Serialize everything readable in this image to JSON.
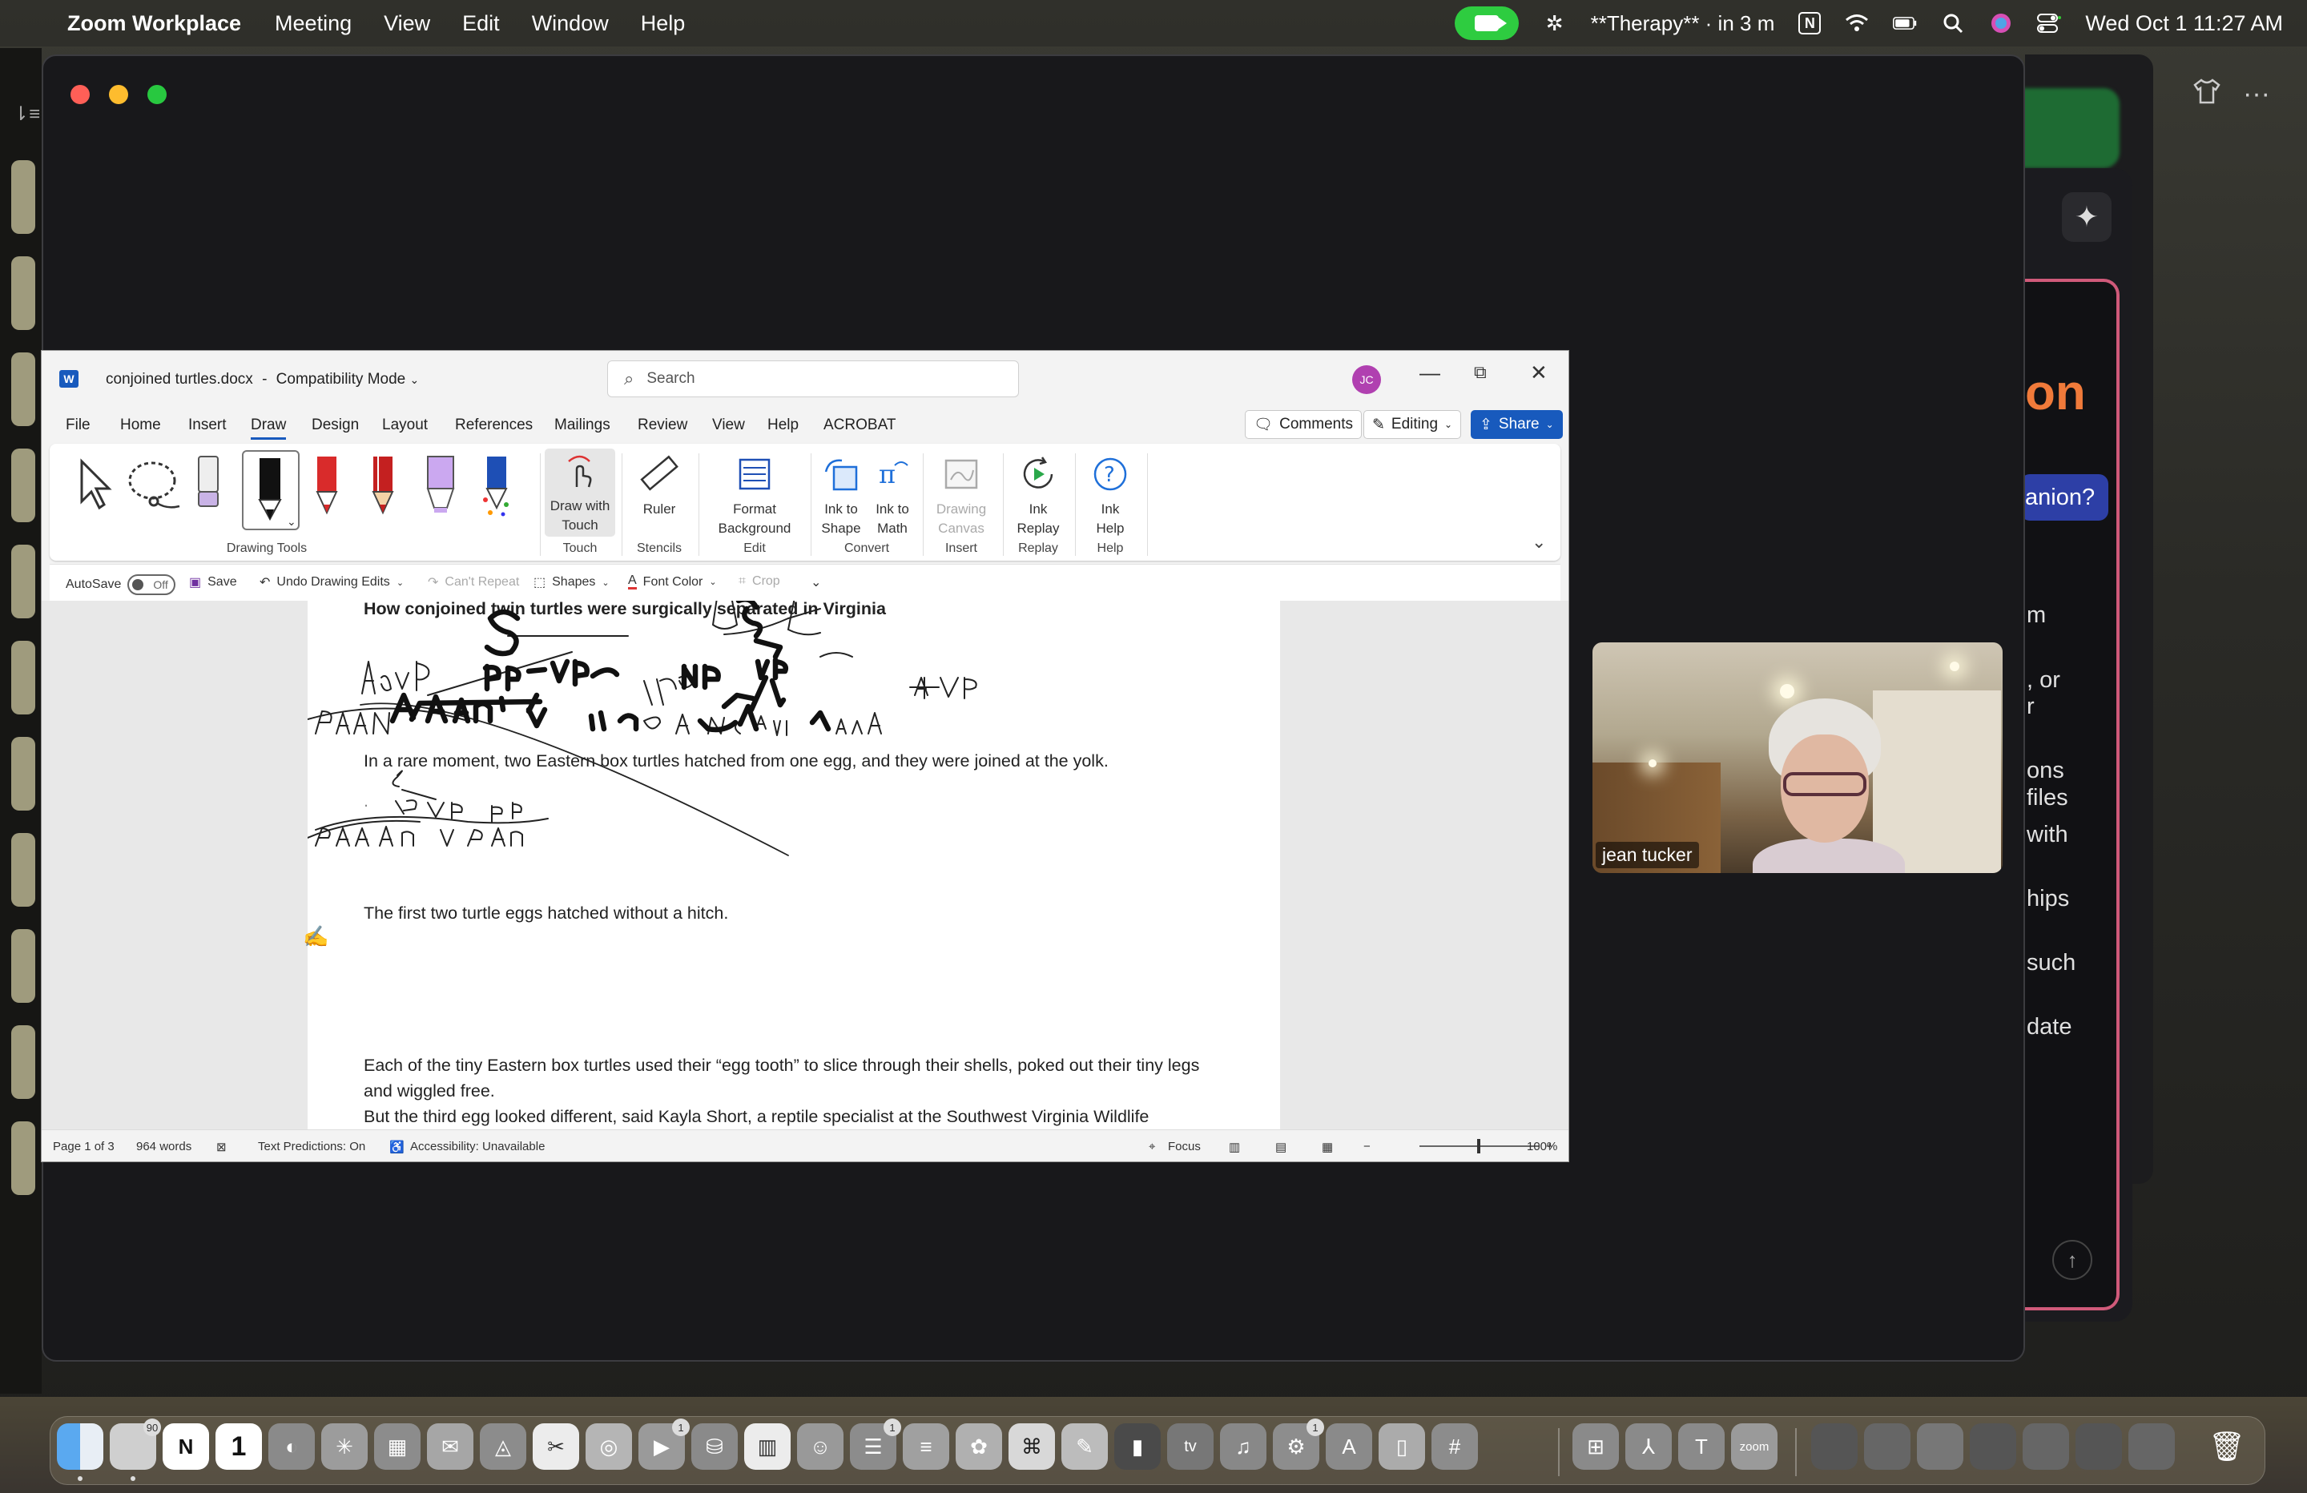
{
  "menubar": {
    "app_name": "Zoom Workplace",
    "items": [
      "Meeting",
      "View",
      "Edit",
      "Window",
      "Help"
    ],
    "status_event": "**Therapy** · in 3 m",
    "clock": "Wed Oct 1  11:27 AM"
  },
  "companion": {
    "heading_fragment": "on",
    "pill_fragment": "anion?",
    "lines": [
      "m",
      ", or",
      "r",
      "ons",
      "files",
      "with",
      "hips",
      "such",
      "date"
    ]
  },
  "word": {
    "title": "conjoined turtles.docx",
    "separator": "-",
    "mode": "Compatibility Mode",
    "search_placeholder": "Search",
    "avatar_initials": "JC",
    "tabs": [
      "File",
      "Home",
      "Insert",
      "Draw",
      "Design",
      "Layout",
      "References",
      "Mailings",
      "Review",
      "View",
      "Help",
      "ACROBAT"
    ],
    "active_tab": "Draw",
    "comments_label": "Comments",
    "editing_label": "Editing",
    "share_label": "Share",
    "ribbon": {
      "drawing_tools_label": "Drawing Tools",
      "draw_with_touch": "Draw with Touch",
      "touch_label": "Touch",
      "ruler": "Ruler",
      "stencils_label": "Stencils",
      "format_background": "Format Background",
      "edit_label": "Edit",
      "ink_to_shape": "Ink to Shape",
      "ink_to_math": "Ink to Math",
      "convert_label": "Convert",
      "drawing_canvas": "Drawing Canvas",
      "insert_label": "Insert",
      "ink_replay": "Ink Replay",
      "replay_label": "Replay",
      "ink_help": "Ink Help",
      "help_label": "Help"
    },
    "qat": {
      "autosave": "AutoSave",
      "autosave_state": "Off",
      "save": "Save",
      "undo": "Undo Drawing Edits",
      "cant_repeat": "Can't Repeat",
      "shapes": "Shapes",
      "font_color": "Font Color",
      "crop": "Crop"
    },
    "document": {
      "headline": "How conjoined twin turtles were surgically separated in Virginia",
      "p1": "In a rare moment, two Eastern box turtles hatched from one egg, and they were joined at the yolk.",
      "p2_dot": ".",
      "p3": "The first two turtle eggs hatched without a hitch.",
      "p4": "Each of the tiny Eastern box turtles used their “egg tooth” to slice through their shells, poked out their tiny legs and wiggled free.",
      "p5": "But the third egg looked different, said Kayla Short, a reptile specialist at the Southwest Virginia Wildlife"
    },
    "status": {
      "page": "Page 1 of 3",
      "words": "964 words",
      "text_predictions": "Text Predictions: On",
      "accessibility": "Accessibility: Unavailable",
      "focus": "Focus",
      "zoom": "100%"
    }
  },
  "video": {
    "participant_name": "jean tucker"
  },
  "dock": {
    "badges": {
      "mail": "90",
      "calendar_day": "1",
      "zoom": "1",
      "reminders": "1",
      "settings": "1"
    },
    "apps": [
      "finder",
      "messages-like",
      "notion",
      "calendar",
      "arc",
      "perplexity",
      "launchpad",
      "mail",
      "affinity",
      "scripts",
      "chrome",
      "facetime",
      "reminders-like",
      "barcode",
      "contacts",
      "reminders",
      "notes",
      "photos",
      "chatgpt",
      "pages",
      "prompt",
      "tv",
      "music",
      "system-settings",
      "app-store",
      "office",
      "slack",
      "grid",
      "acrobat",
      "teams",
      "zoom"
    ],
    "tv_label": "tv",
    "zoom_label": "zoom",
    "notion_glyph": "N",
    "calendar_glyph": "1"
  }
}
